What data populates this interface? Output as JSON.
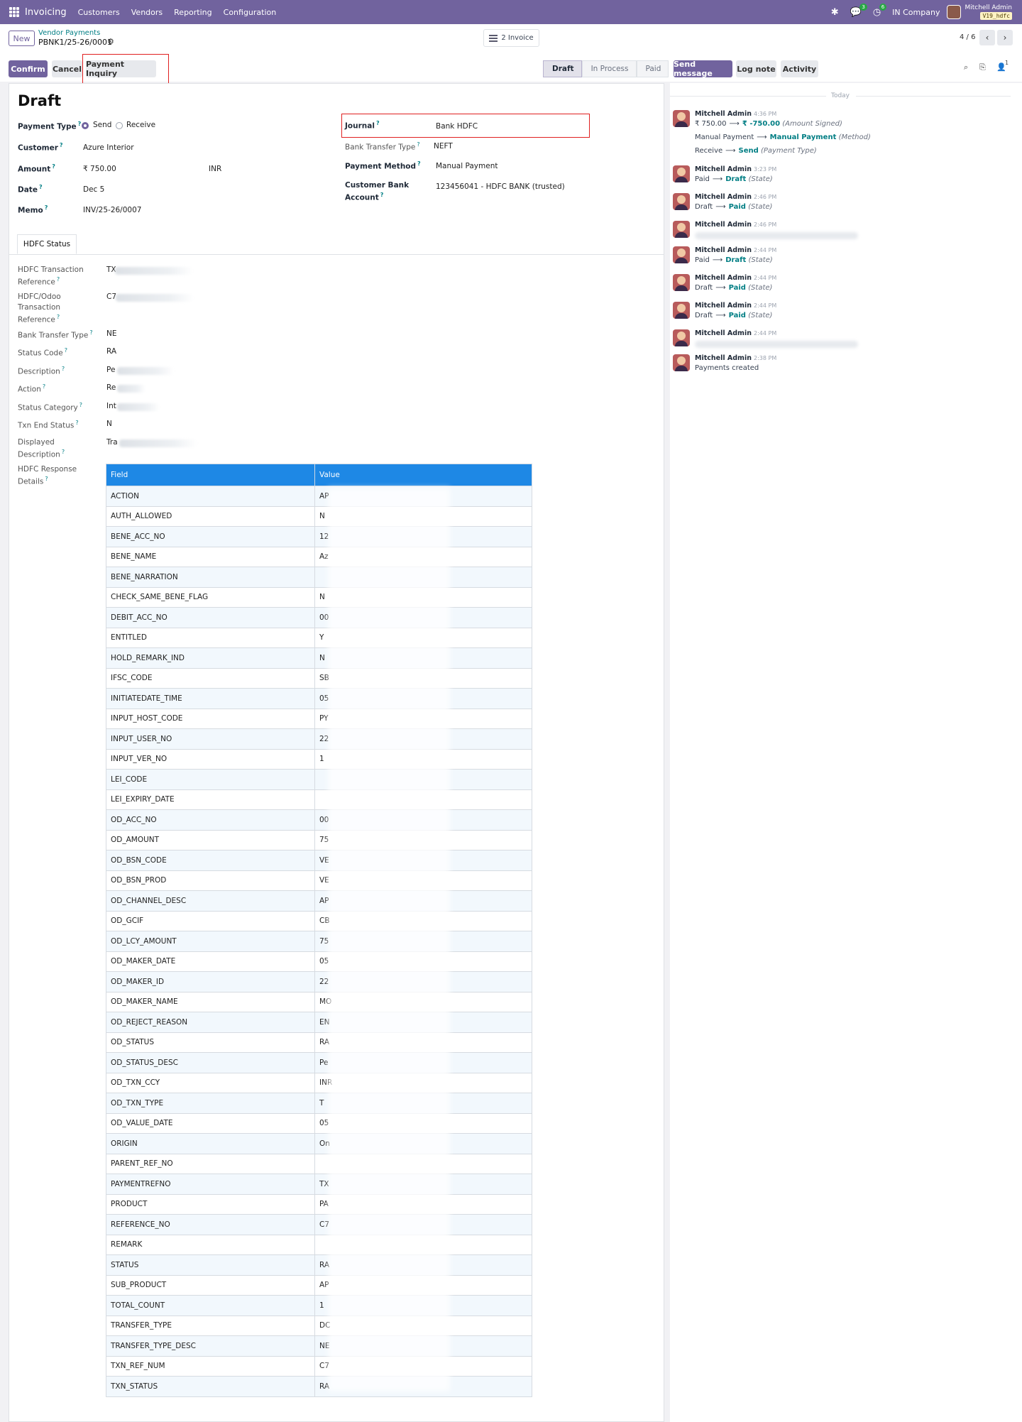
{
  "navbar": {
    "app": "Invoicing",
    "menu": [
      "Customers",
      "Vendors",
      "Reporting",
      "Configuration"
    ],
    "messages_badge": "3",
    "activities_badge": "6",
    "company": "IN Company",
    "user": "Mitchell Admin",
    "db": "V19_hdfc"
  },
  "control": {
    "new_label": "New",
    "breadcrumb_parent": "Vendor Payments",
    "breadcrumb_current": "PBNK1/25-26/0001",
    "smart_button": "2 Invoice",
    "pager": "4 / 6",
    "buttons": {
      "confirm": "Confirm",
      "cancel": "Cancel",
      "inquiry": "Payment Inquiry"
    },
    "statusbar": [
      "Draft",
      "In Process",
      "Paid"
    ],
    "chatter_buttons": {
      "send": "Send message",
      "log": "Log note",
      "activity": "Activity"
    },
    "followers": "1"
  },
  "form": {
    "title": "Draft",
    "payment_type": {
      "label": "Payment Type",
      "send": "Send",
      "receive": "Receive"
    },
    "customer": {
      "label": "Customer",
      "value": "Azure Interior"
    },
    "amount": {
      "label": "Amount",
      "value": "₹ 750.00",
      "currency": "INR"
    },
    "date": {
      "label": "Date",
      "value": "Dec 5"
    },
    "memo": {
      "label": "Memo",
      "value": "INV/25-26/0007"
    },
    "journal": {
      "label": "Journal",
      "value": "Bank HDFC"
    },
    "bank_transfer_type": {
      "label": "Bank Transfer Type",
      "value": "NEFT"
    },
    "payment_method": {
      "label": "Payment Method",
      "value": "Manual Payment"
    },
    "customer_bank": {
      "label1": "Customer Bank",
      "label2": "Account",
      "value": "123456041 - HDFC BANK (trusted)"
    }
  },
  "tab": {
    "label": "HDFC Status"
  },
  "hdfc": {
    "txn_ref": {
      "l1": "HDFC Transaction",
      "l2": "Reference",
      "v": "TX"
    },
    "odoo_ref": {
      "l1": "HDFC/Odoo",
      "l2": "Transaction",
      "l3": "Reference",
      "v": "C7"
    },
    "bank_transfer": {
      "l1": "Bank Transfer Type",
      "v": "NE"
    },
    "status_code": {
      "l1": "Status Code",
      "v": "RA"
    },
    "description": {
      "l1": "Description",
      "v": "Pe"
    },
    "action": {
      "l1": "Action",
      "v": "Re"
    },
    "status_category": {
      "l1": "Status Category",
      "v": "Int"
    },
    "txn_end": {
      "l1": "Txn End Status",
      "v": "N"
    },
    "displayed_desc": {
      "l1": "Displayed",
      "l2": "Description",
      "v": "Tra"
    },
    "response": {
      "l1": "HDFC Response",
      "l2": "Details"
    }
  },
  "response_table": {
    "headers": [
      "Field",
      "Value"
    ],
    "rows": [
      [
        "ACTION",
        "AP"
      ],
      [
        "AUTH_ALLOWED",
        "N"
      ],
      [
        "BENE_ACC_NO",
        "12"
      ],
      [
        "BENE_NAME",
        "Az"
      ],
      [
        "BENE_NARRATION",
        ""
      ],
      [
        "CHECK_SAME_BENE_FLAG",
        "N"
      ],
      [
        "DEBIT_ACC_NO",
        "00"
      ],
      [
        "ENTITLED",
        "Y"
      ],
      [
        "HOLD_REMARK_IND",
        "N"
      ],
      [
        "IFSC_CODE",
        "SB"
      ],
      [
        "INITIATEDATE_TIME",
        "05"
      ],
      [
        "INPUT_HOST_CODE",
        "PY"
      ],
      [
        "INPUT_USER_NO",
        "22"
      ],
      [
        "INPUT_VER_NO",
        "1"
      ],
      [
        "LEI_CODE",
        ""
      ],
      [
        "LEI_EXPIRY_DATE",
        ""
      ],
      [
        "OD_ACC_NO",
        "00"
      ],
      [
        "OD_AMOUNT",
        "75"
      ],
      [
        "OD_BSN_CODE",
        "VE"
      ],
      [
        "OD_BSN_PROD",
        "VE"
      ],
      [
        "OD_CHANNEL_DESC",
        "AP"
      ],
      [
        "OD_GCIF",
        "CB"
      ],
      [
        "OD_LCY_AMOUNT",
        "75"
      ],
      [
        "OD_MAKER_DATE",
        "05"
      ],
      [
        "OD_MAKER_ID",
        "22"
      ],
      [
        "OD_MAKER_NAME",
        "MO"
      ],
      [
        "OD_REJECT_REASON",
        "EN"
      ],
      [
        "OD_STATUS",
        "RA"
      ],
      [
        "OD_STATUS_DESC",
        "Pe"
      ],
      [
        "OD_TXN_CCY",
        "INR"
      ],
      [
        "OD_TXN_TYPE",
        "T"
      ],
      [
        "OD_VALUE_DATE",
        "05"
      ],
      [
        "ORIGIN",
        "On"
      ],
      [
        "PARENT_REF_NO",
        ""
      ],
      [
        "PAYMENTREFNO",
        "TX"
      ],
      [
        "PRODUCT",
        "PA"
      ],
      [
        "REFERENCE_NO",
        "C7"
      ],
      [
        "REMARK",
        ""
      ],
      [
        "STATUS",
        "RA"
      ],
      [
        "SUB_PRODUCT",
        "AP"
      ],
      [
        "TOTAL_COUNT",
        "1"
      ],
      [
        "TRANSFER_TYPE",
        "DC"
      ],
      [
        "TRANSFER_TYPE_DESC",
        "NE"
      ],
      [
        "TXN_REF_NUM",
        "C7"
      ],
      [
        "TXN_STATUS",
        "RA"
      ]
    ]
  },
  "chatter": {
    "today": "Today",
    "messages": [
      {
        "author": "Mitchell Admin",
        "time": "4:36 PM"
      },
      {
        "author": "Mitchell Admin",
        "time": "3:23 PM"
      },
      {
        "author": "Mitchell Admin",
        "time": "2:46 PM"
      },
      {
        "author": "Mitchell Admin",
        "time": "2:46 PM"
      },
      {
        "author": "Mitchell Admin",
        "time": "2:44 PM"
      },
      {
        "author": "Mitchell Admin",
        "time": "2:44 PM"
      },
      {
        "author": "Mitchell Admin",
        "time": "2:44 PM"
      },
      {
        "author": "Mitchell Admin",
        "time": "2:44 PM"
      },
      {
        "author": "Mitchell Admin",
        "time": "2:38 PM"
      }
    ],
    "m1": {
      "from": "₹ 750.00",
      "to": "₹ -750.00",
      "field": "(Amount Signed)",
      "from2": "Manual Payment",
      "to2": "Manual Payment",
      "field2": "(Method)",
      "from3": "Receive",
      "to3": "Send",
      "field3": "(Payment Type)"
    },
    "m2": {
      "from": "Paid",
      "to": "Draft",
      "field": "(State)"
    },
    "m3": {
      "from": "Draft",
      "to": "Paid",
      "field": "(State)"
    },
    "m5": {
      "from": "Paid",
      "to": "Draft",
      "field": "(State)"
    },
    "m6": {
      "from": "Draft",
      "to": "Paid",
      "field": "(State)"
    },
    "m7": {
      "from": "Draft",
      "to": "Paid",
      "field": "(State)"
    },
    "m9": {
      "text": "Payments created"
    }
  }
}
